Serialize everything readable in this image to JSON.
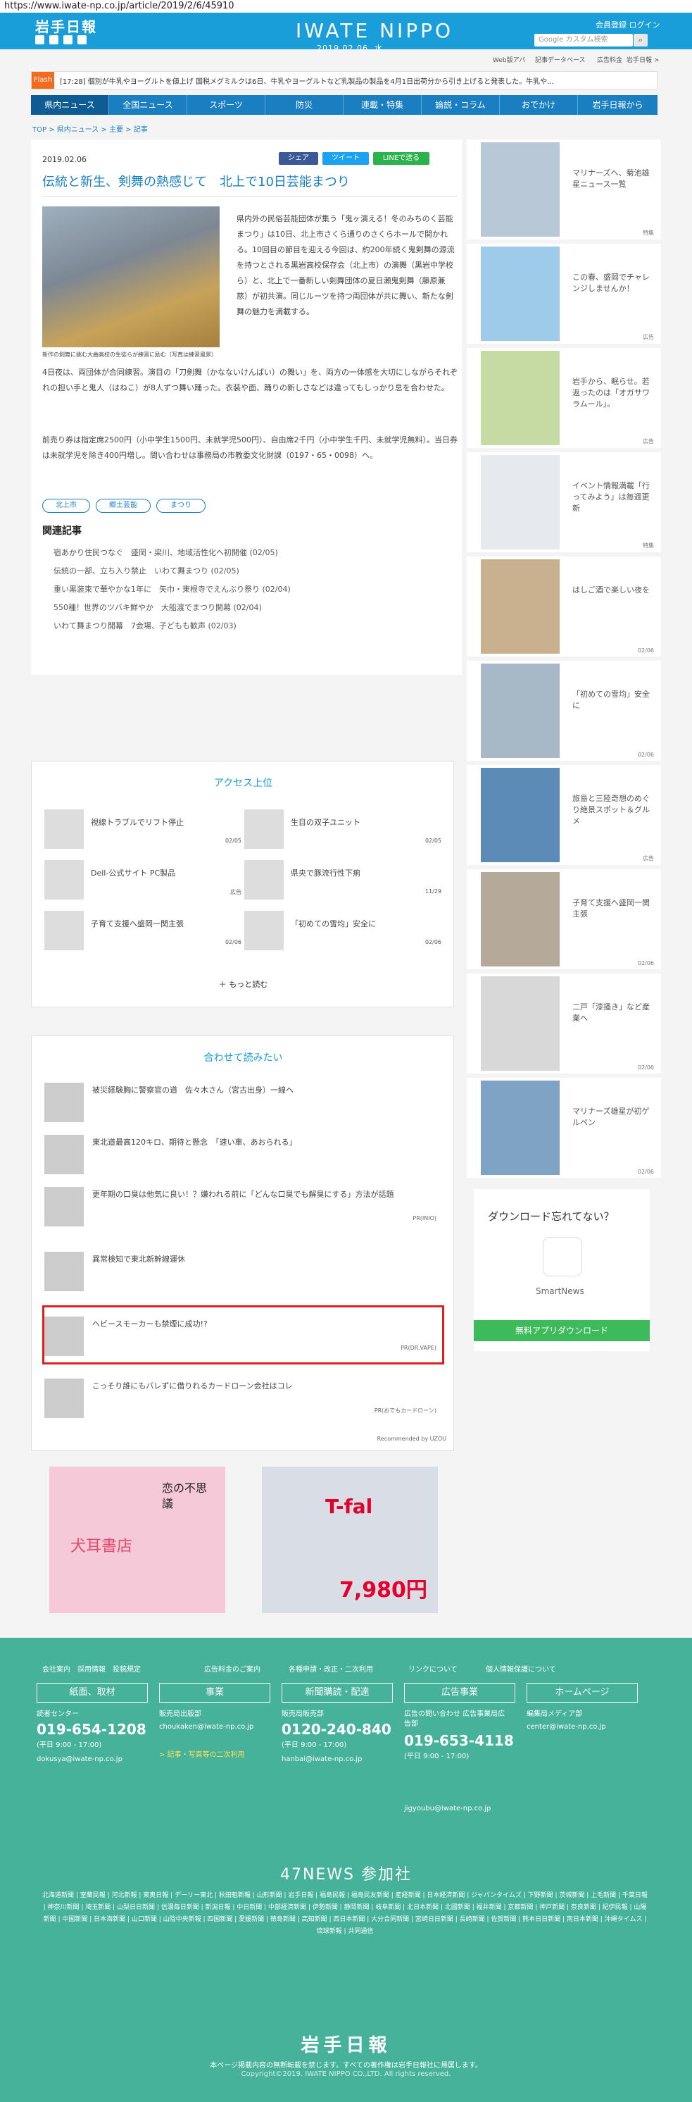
{
  "url": "https://www.iwate-np.co.jp/article/2019/2/6/45910",
  "header": {
    "logo": "岩手日報",
    "brand": "IWATE NIPPO",
    "date": "2019.02.06. 水",
    "account": "会員登録 ログイン",
    "search_placeholder": "Google カスタム検索",
    "search_icon": "search-icon"
  },
  "subnav": [
    "Web版アバ",
    "記事データベース",
    "広告料金",
    "岩手日報 >"
  ],
  "flash": {
    "label": "Flash",
    "text": "[17:28] 個別が牛乳やヨーグルトを値上げ 国税メグミルクは6日、牛乳やヨーグルトなど乳製品の製品を4月1日出荷分から引き上げると発表した。牛乳や..."
  },
  "nav": [
    "県内ニュース",
    "全国ニュース",
    "スポーツ",
    "防災",
    "連載・特集",
    "論説・コラム",
    "おでかけ",
    "岩手日報から"
  ],
  "breadcrumb": "TOP > 県内ニュース > 主要 > 記事",
  "article": {
    "date": "2019.02.06",
    "share": [
      "シェア",
      "ツイート",
      "LINEで送る"
    ],
    "title": "伝統と新生、剣舞の熱感じて　北上で10日芸能まつり",
    "caption": "新作の剣舞に挑む大曲高校の生徒らが練習に励む（写真は練習風景）",
    "p1": "県内外の民俗芸能団体が集う「鬼ヶ演える！冬のみちのく芸能まつり」は10日、北上市さくら通りのさくらホールで開かれる。10回目の節目を迎える今回は、約200年続く鬼剣舞の源流を持つとされる黒岩高校保存会（北上市）の演舞（黒岩中学校ら）と、北上で一番新しい剣舞団体の夏日瀬鬼剣舞（藤原兼慈）が初共演。同じルーツを持つ両団体が共に舞い、新たな剣舞の魅力を満載する。",
    "p2": "4日夜は、両団体が合同練習。演目の「刀剣舞（かなないけんばい）の舞い」を、両方の一体感を大切にしながらそれぞれの担い手と鬼人（はねこ）が8人ずつ舞い踊った。衣装や面、踊りの新しさなどは違ってもしっかり息を合わせた。",
    "p3": "前売り券は指定席2500円（小中学生1500円、未就学児500円）、自由席2千円（小中学生千円、未就学児無料）。当日券は未就学児を除き400円増し。問い合わせは事務局の市教委文化財課（0197・65・0098）へ。",
    "tags": [
      "北上市",
      "郷土芸能",
      "まつり"
    ],
    "related_title": "関連記事",
    "related": [
      "宿あかり住民つなぐ　盛岡・梁川、地域活性化へ初開催 (02/05)",
      "伝統の一部、立ち入り禁止　いわて舞まつり (02/05)",
      "重い黒装束で華やかな1年に　矢巾・東根寺でえんぶり祭り (02/04)",
      "550種！世界のツバキ鮮やか　大船渡でまつり開幕 (02/04)",
      "いわて舞まつり開幕　7会場、子どもも歓声 (02/03)"
    ]
  },
  "sidebar": [
    {
      "text": "マリナーズへ、菊池雄星ニュース一覧",
      "date": "特集"
    },
    {
      "text": "この春、盛岡でチャレンジしませんか！",
      "date": "広告"
    },
    {
      "text": "岩手から、眠らせ。若返ったのは「オガサワラムール」。",
      "date": "広告"
    },
    {
      "text": "イベント情報満載「行ってみよう」は毎週更新",
      "date": "特集"
    },
    {
      "text": "はしご酒で楽しい夜を",
      "date": "02/06"
    },
    {
      "text": "「初めての雪均」安全に",
      "date": "02/06"
    },
    {
      "text": "旅島と三陸奇想のめぐり絶景スポット＆グルメ",
      "date": "広告"
    },
    {
      "text": "子育て支援へ盛岡一関主張",
      "date": "02/06"
    },
    {
      "text": "二戸「漆搔き」など産業へ",
      "date": "02/06"
    },
    {
      "text": "マリナーズ雄星が初ゲルペン",
      "date": "02/06"
    }
  ],
  "ad_news": {
    "title": "ダウンロード忘れてない？",
    "app": "SmartNews",
    "button": "無料アプリダウンロード"
  },
  "access": {
    "title": "アクセス上位",
    "items": [
      {
        "text": "視線トラブルでリフト停止",
        "date": "02/05"
      },
      {
        "text": "生目の双子ユニット",
        "date": "02/05"
      },
      {
        "text": "Dell-公式サイト PC製品",
        "date": "広告"
      },
      {
        "text": "県央で豚流行性下痢",
        "date": "11/29"
      },
      {
        "text": "子育て支援へ盛岡一関主張",
        "date": "02/06"
      },
      {
        "text": "「初めての雪均」安全に",
        "date": "02/06"
      }
    ],
    "more": "もっと読む"
  },
  "recommend": {
    "title": "合わせて読みたい",
    "items": [
      {
        "text": "被災経験胸に警察官の道　佐々木さん（宮古出身）一線へ",
        "pr": ""
      },
      {
        "text": "東北道最高120キロ、期待と懸念　「速い車、あおられる」",
        "pr": ""
      },
      {
        "text": "更年期の口臭は他気に良い！？嫌われる前に「どんな口臭でも解臭にする」方法が話題",
        "pr": "PR(INIO)"
      },
      {
        "text": "異常検知で東北新幹線運休",
        "pr": ""
      },
      {
        "text": "ヘビースモーカーも禁煙に成功!?",
        "pr": "PR(DR.VAPE)"
      },
      {
        "text": "こっそり誰にもバレずに借りれるカードローン会社はコレ",
        "pr": "PR(おでもカードローン)"
      }
    ],
    "powered": "Recommended by UZOU"
  },
  "banners": [
    {
      "text": "犬耳書店",
      "sub": "恋の不思議"
    },
    {
      "text": "T-fal",
      "price": "7,980円"
    }
  ],
  "footer": {
    "links": [
      "会社案内",
      "採用情報",
      "投稿規定",
      "広告料金のご案内",
      "各種申請・改正・二次利用",
      "リンクについて",
      "個人情報保護について"
    ],
    "cols": [
      {
        "h": "紙面、取材",
        "l1": "読者センター",
        "phone": "019-654-1208",
        "l2": "(平日 9:00 - 17:00)",
        "mail": "dokusya@iwate-np.co.jp"
      },
      {
        "h": "事業",
        "l1": "販売局出版部",
        "phone": "",
        "l2": "choukaken@iwate-np.co.jp",
        "mail": "> 記事・写真等の二次利用"
      },
      {
        "h": "新聞購読・配達",
        "l1": "販売局販売部",
        "phone": "0120-240-840",
        "l2": "(平日 9:00 - 17:00)",
        "mail": "hanbai@iwate-np.co.jp"
      },
      {
        "h": "広告事業",
        "l1": "広告の問い合わせ 広告事業局広告部",
        "phone": "019-653-4118",
        "l2": "(平日 9:00 - 17:00)",
        "mail": "jigyoubu@iwate-np.co.jp"
      },
      {
        "h": "ホームページ",
        "l1": "編集局メディア部",
        "phone": "",
        "l2": "center@iwate-np.co.jp",
        "mail": ""
      }
    ],
    "n47": "47NEWS 参加社",
    "members": "北海道新聞 | 室蘭民報 | 河北新報 | 東奥日報 | デーリー東北 | 秋田魁新報 | 山形新聞 | 岩手日報 | 福島民報 | 福島民友新聞 | 産経新聞 | 日本経済新聞 | ジャパンタイムズ | 下野新聞 | 茨城新聞 | 上毛新聞 | 千葉日報 | 神奈川新聞 | 埼玉新聞 | 山梨日日新聞 | 信濃毎日新聞 | 新潟日報 | 中日新聞 | 中部経済新聞 | 伊勢新聞 | 静岡新聞 | 岐阜新聞 | 北日本新聞 | 北國新聞 | 福井新聞 | 京都新聞 | 神戸新聞 | 奈良新聞 | 紀伊民報 | 山陽新聞 | 中国新聞 | 日本海新聞 | 山口新聞 | 山陰中央新報 | 四国新聞 | 愛媛新聞 | 徳島新聞 | 高知新聞 | 西日本新聞 | 大分合同新聞 | 宮崎日日新聞 | 長崎新聞 | 佐賀新聞 | 熊本日日新聞 | 南日本新聞 | 沖縄タイムス | 琉球新報 | 共同通信",
    "logo": "岩手日報",
    "note": "本ページ掲載内容の無断転載を禁じます。すべての著作権は岩手日報社に帰属します。",
    "copy": "Copyright©2019. IWATE NIPPO CO.,LTD. All rights reserved."
  }
}
